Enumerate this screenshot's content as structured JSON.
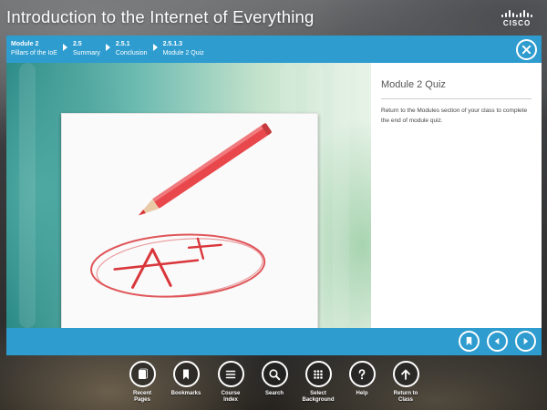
{
  "app": {
    "title": "Introduction to the Internet of Everything",
    "logo_text": "CISCO"
  },
  "breadcrumb": [
    {
      "num": "Module 2",
      "text": "Pillars of the IoE"
    },
    {
      "num": "2.5",
      "text": "Summary"
    },
    {
      "num": "2.5.1",
      "text": "Conclusion"
    },
    {
      "num": "2.5.1.3",
      "text": "Module 2 Quiz"
    }
  ],
  "content": {
    "title": "Module 2 Quiz",
    "body": "Return to the Modules section of your class to complete the end of module quiz.",
    "image_text": "A+"
  },
  "dock": [
    {
      "line1": "Recent",
      "line2": "Pages",
      "icon": "recent-pages-icon"
    },
    {
      "line1": "Bookmarks",
      "line2": "",
      "icon": "bookmark-icon"
    },
    {
      "line1": "Course",
      "line2": "Index",
      "icon": "course-index-icon"
    },
    {
      "line1": "Search",
      "line2": "",
      "icon": "search-icon"
    },
    {
      "line1": "Select",
      "line2": "Background",
      "icon": "grid-icon"
    },
    {
      "line1": "Help",
      "line2": "",
      "icon": "help-icon"
    },
    {
      "line1": "Return to",
      "line2": "Class",
      "icon": "up-arrow-icon"
    }
  ],
  "colors": {
    "accent": "#2e9ccf",
    "pencil": "#e8474b",
    "ink": "#d9363b"
  }
}
